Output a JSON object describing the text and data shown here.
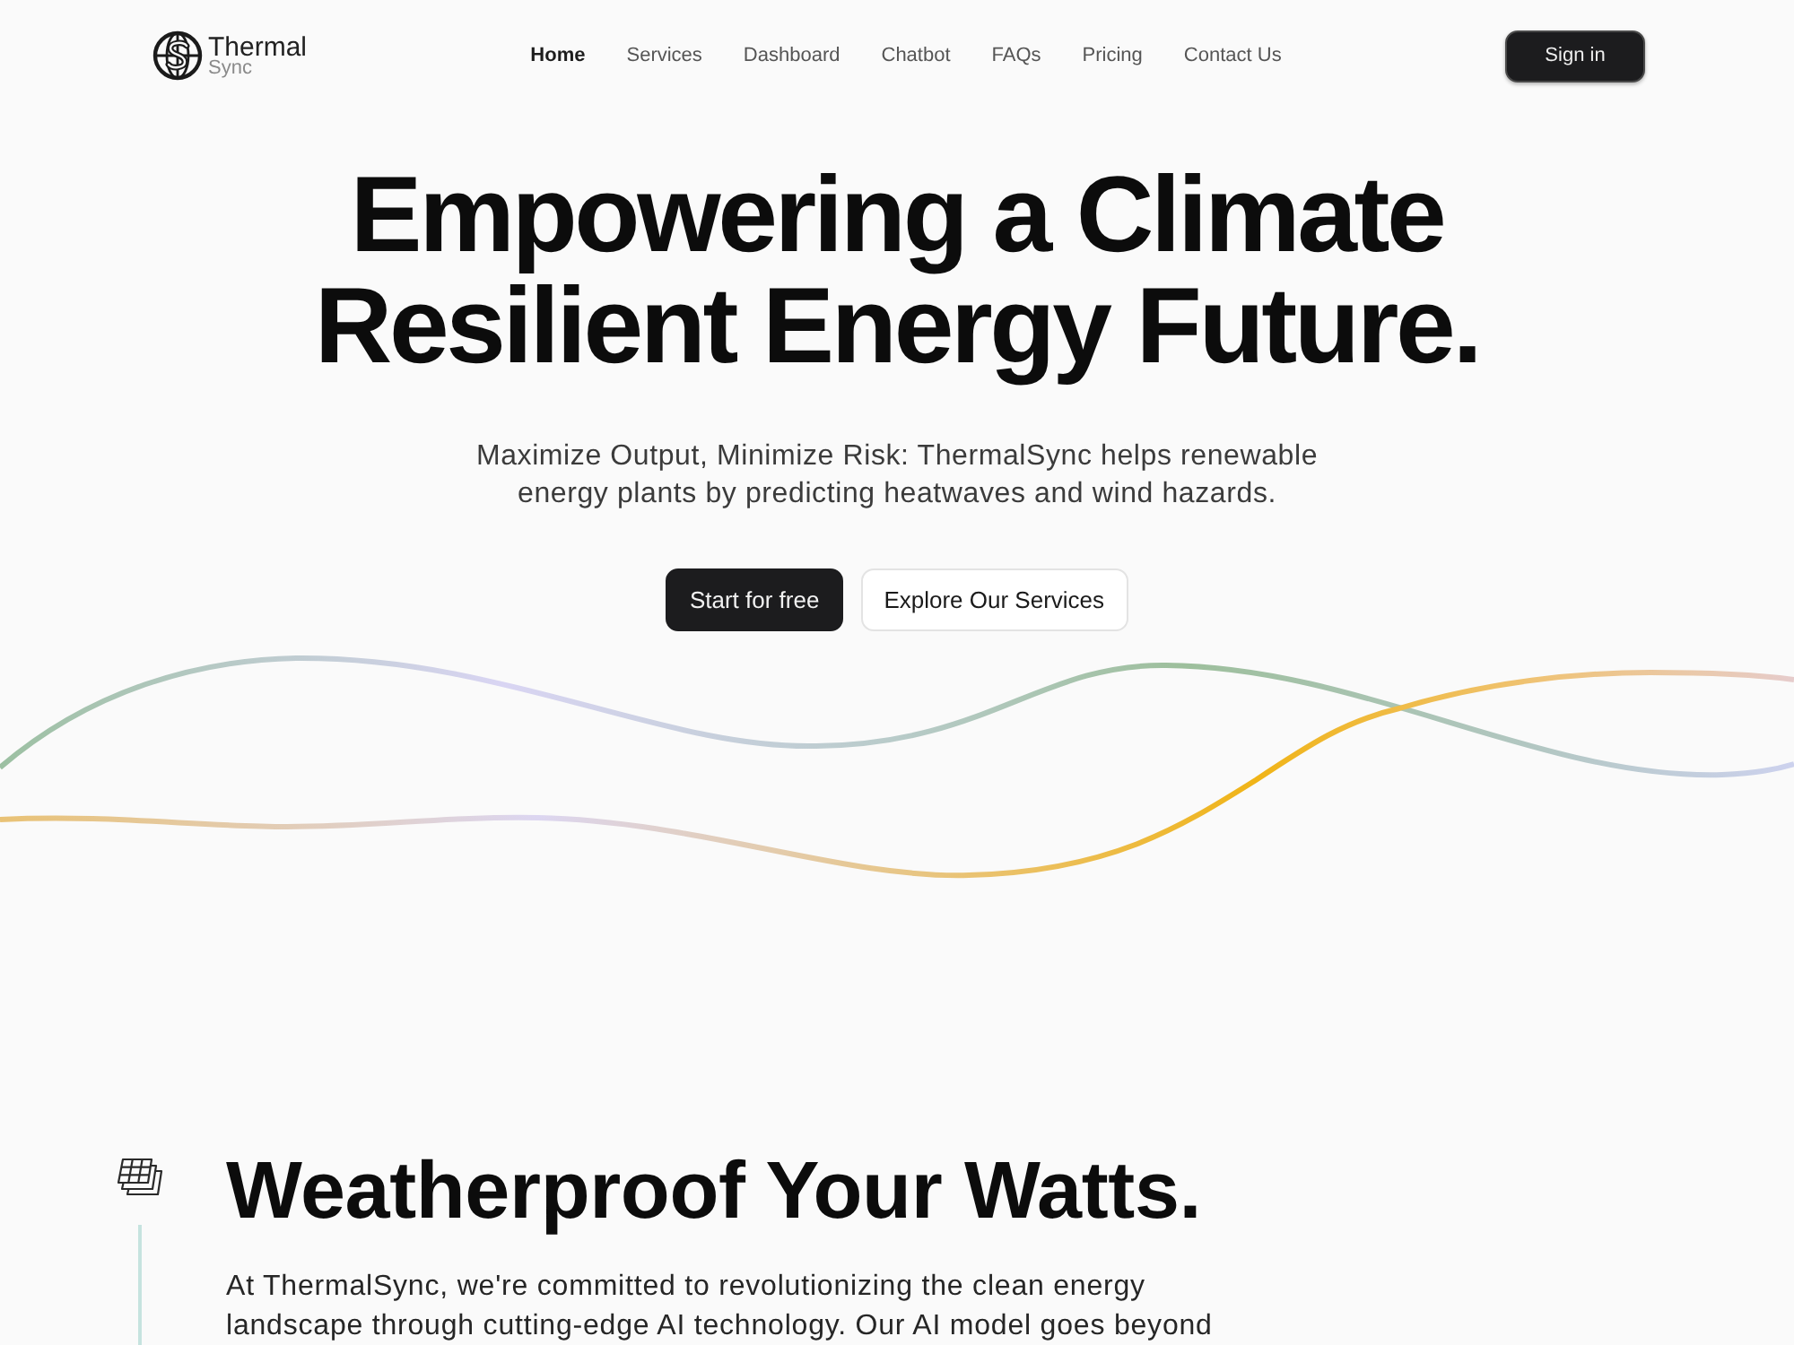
{
  "nav": {
    "logo": {
      "title": "Thermal",
      "subtitle": "Sync"
    },
    "links": [
      {
        "label": "Home",
        "selected": true
      },
      {
        "label": "Services",
        "selected": false
      },
      {
        "label": "Dashboard",
        "selected": false
      },
      {
        "label": "Chatbot",
        "selected": false
      },
      {
        "label": "FAQs",
        "selected": false
      },
      {
        "label": "Pricing",
        "selected": false
      },
      {
        "label": "Contact Us",
        "selected": false
      }
    ],
    "sign_in": "Sign in"
  },
  "hero": {
    "title": "Empowering a Climate Resilient Energy Future.",
    "subtitle": "Maximize Output, Minimize Risk: ThermalSync helps renewable energy plants by predicting heatwaves and wind hazards.",
    "buttons": [
      {
        "label": "Start for free",
        "kind": "primary"
      },
      {
        "label": "Explore Our Services",
        "kind": "secondary"
      }
    ]
  },
  "section": {
    "title": "Weatherproof Your Watts.",
    "body": "At ThermalSync, we're committed to revolutionizing the clean energy landscape through cutting-edge AI technology. Our AI model goes beyond"
  }
}
